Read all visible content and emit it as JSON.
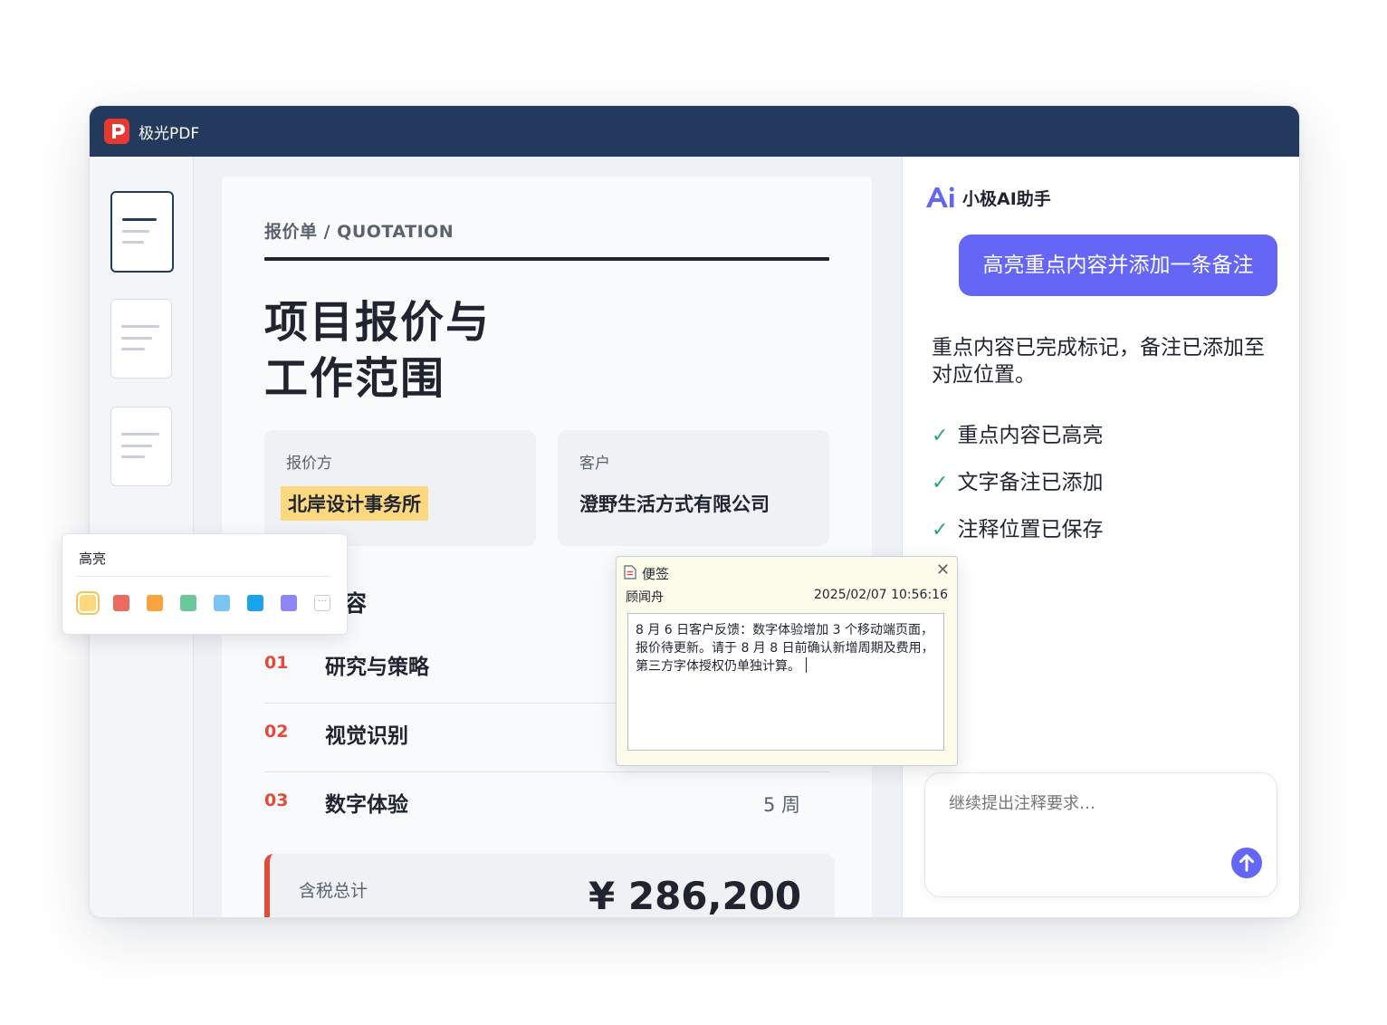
{
  "app": {
    "name": "极光PDF"
  },
  "document": {
    "label": "报价单 / QUOTATION",
    "title_line1": "项目报价与",
    "title_line2": "工作范围",
    "quoter": {
      "key": "报价方",
      "value": "北岸设计事务所"
    },
    "client": {
      "key": "客户",
      "value": "澄野生活方式有限公司"
    },
    "section_title_partial": "容",
    "rows": [
      {
        "num": "01",
        "name": "研究与策略",
        "duration": ""
      },
      {
        "num": "02",
        "name": "视觉识别",
        "duration": ""
      },
      {
        "num": "03",
        "name": "数字体验",
        "duration": "5 周"
      }
    ],
    "total": {
      "key": "含税总计",
      "value": "¥ 286,200"
    }
  },
  "highlight_popup": {
    "title": "高亮",
    "swatches": [
      "#fcd87e",
      "#ec6a5e",
      "#f7a33e",
      "#6cc79a",
      "#7cc5f2",
      "#1aa3ee",
      "#8d86f4"
    ],
    "more_label": "···"
  },
  "sticky_note": {
    "title": "便签",
    "author": "顾闻舟",
    "timestamp": "2025/02/07 10:56:16",
    "body": "8 月 6 日客户反馈：数字体验增加 3 个移动端页面，报价待更新。请于 8 月 8 日前确认新增周期及费用，第三方字体授权仍单独计算。"
  },
  "ai_panel": {
    "title": "小极AI助手",
    "user_message": "高亮重点内容并添加一条备注",
    "reply": "重点内容已完成标记，备注已添加至对应位置。",
    "checks": [
      "重点内容已高亮",
      "文字备注已添加",
      "注释位置已保存"
    ],
    "input_placeholder": "继续提出注释要求…"
  },
  "colors": {
    "titlebar": "#233a5e",
    "accent": "#6566f5",
    "number_red": "#e24a3b",
    "check_green": "#2aa57a"
  }
}
